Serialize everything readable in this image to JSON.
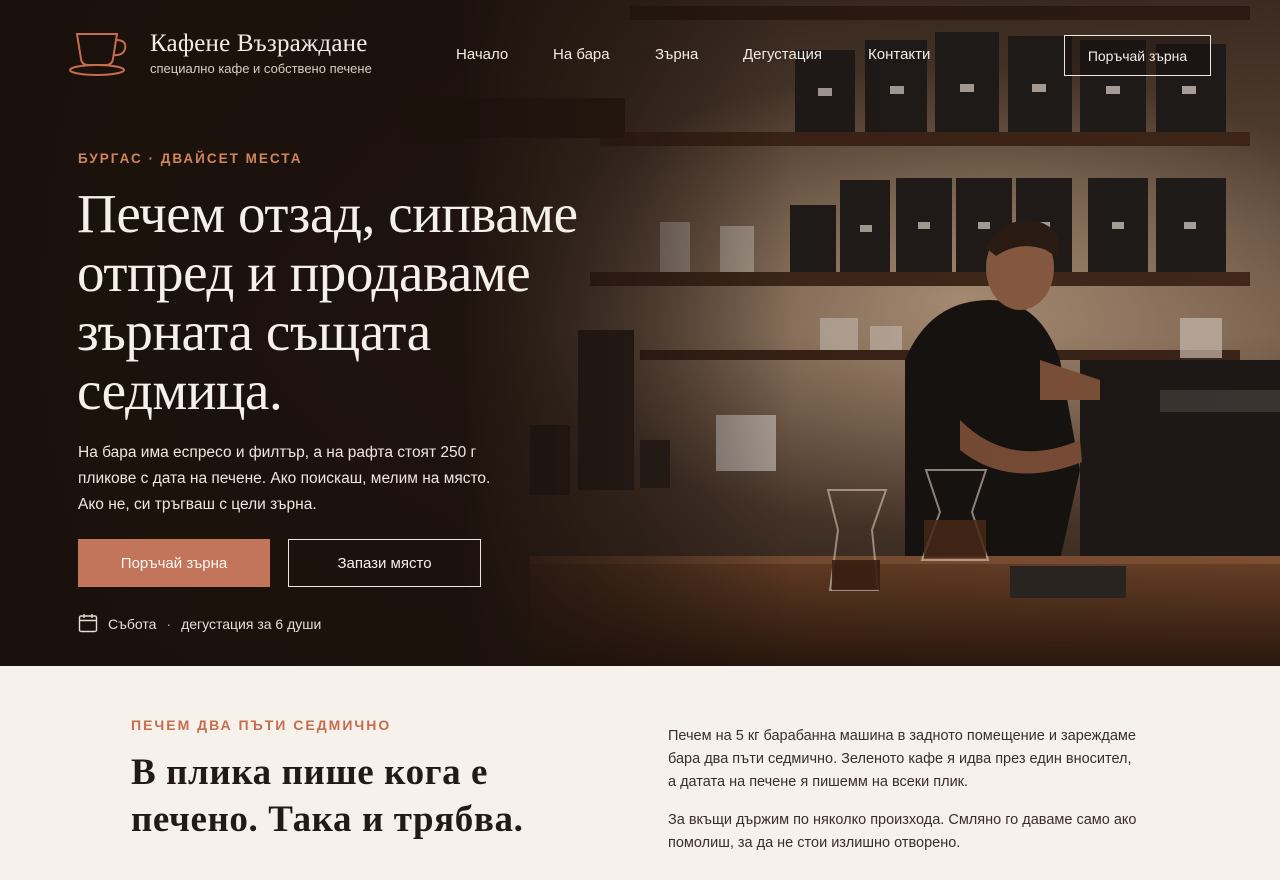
{
  "header": {
    "brand_name": "Кафене Възраждане",
    "brand_tagline": "специално кафе и собствено печене",
    "nav": [
      "Начало",
      "На бара",
      "Зърна",
      "Дегустация",
      "Контакти"
    ],
    "cta": "Поръчай зърна"
  },
  "hero": {
    "eyebrow": "БУРГАС · ДВАЙСЕТ МЕСТА",
    "headline": "Печем отзад, сипваме отпред и продаваме зърната същата седмица.",
    "lede": "На бара има еспресо и филтър, а на рафта стоят 250 г пликове с дата на печене. Ако поискаш, мелим на място. Ако не, си тръгваш с цели зърна.",
    "primary_button": "Поръчай зърна",
    "secondary_button": "Запази място",
    "event_day": "Събота",
    "event_separator": "·",
    "event_text": "дегустация за 6 души"
  },
  "roasting": {
    "eyebrow": "ПЕЧЕМ ДВА ПЪТИ СЕДМИЧНО",
    "title": "В плика пише кога е печено. Така и трябва.",
    "paragraph_1": "Печем на 5 кг барабанна машина в задното помещение и зареждаме бара два пъти седмично. Зеленото кафе я идва през един вносител, а датата на печене я пишемм на всеки плик.",
    "paragraph_2": "За вкъщи държим по няколко произхода. Смляно го даваме само ако помолиш, за да не стои излишно отворено."
  },
  "icons": {
    "logo": "coffee-cup-icon",
    "event": "calendar-icon"
  },
  "colors": {
    "accent": "#c2755a",
    "eyebrow": "#d0855d",
    "hero_bg": "#1a110c",
    "section_bg": "#f6f1ea"
  }
}
